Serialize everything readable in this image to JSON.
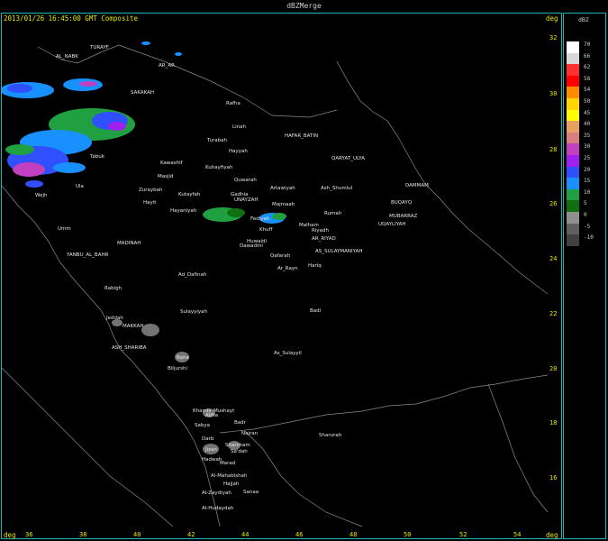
{
  "window": {
    "title": "dBZMerge"
  },
  "header": {
    "timestamp": "2013/01/26 16:45:00 GMT Composite",
    "unit": "deg"
  },
  "axes": {
    "corner_label_x": "deg",
    "corner_label_y": "deg",
    "lat_ticks": [
      "32",
      "30",
      "28",
      "26",
      "24",
      "22",
      "20",
      "18",
      "16"
    ],
    "lon_ticks": [
      "36",
      "38",
      "40",
      "42",
      "44",
      "46",
      "48",
      "50",
      "52",
      "54"
    ]
  },
  "legend": {
    "unit": "dBZ",
    "entries": [
      {
        "label": "70",
        "color": "#ffffff"
      },
      {
        "label": "66",
        "color": "#d8d8d8"
      },
      {
        "label": "62",
        "color": "#ff3030"
      },
      {
        "label": "58",
        "color": "#ff0000"
      },
      {
        "label": "54",
        "color": "#ff8c00"
      },
      {
        "label": "50",
        "color": "#ffd700"
      },
      {
        "label": "45",
        "color": "#ffff00"
      },
      {
        "label": "40",
        "color": "#e8a060"
      },
      {
        "label": "35",
        "color": "#d88080"
      },
      {
        "label": "30",
        "color": "#c040c0"
      },
      {
        "label": "25",
        "color": "#a020f0"
      },
      {
        "label": "20",
        "color": "#3050ff"
      },
      {
        "label": "15",
        "color": "#1890ff"
      },
      {
        "label": "10",
        "color": "#20a040"
      },
      {
        "label": "5",
        "color": "#107010"
      },
      {
        "label": "0",
        "color": "#909090"
      },
      {
        "label": "-5",
        "color": "#606060"
      },
      {
        "label": "-10",
        "color": "#404040"
      }
    ]
  },
  "places": [
    {
      "name": "TURAYF"
    },
    {
      "name": "AL_NABK"
    },
    {
      "name": "AR_AR"
    },
    {
      "name": "SAKAKAH"
    },
    {
      "name": "Rafha"
    },
    {
      "name": "Linah"
    },
    {
      "name": "HAFAR_BATIN"
    },
    {
      "name": "Turabah"
    },
    {
      "name": "Hayyah"
    },
    {
      "name": "QARYAT_ULYA"
    },
    {
      "name": "Tabuk"
    },
    {
      "name": "Kawashif"
    },
    {
      "name": "Kuhayfiyah"
    },
    {
      "name": "Masjid"
    },
    {
      "name": "Quwarah"
    },
    {
      "name": "Ula"
    },
    {
      "name": "Zuraybah"
    },
    {
      "name": "Kutayfah"
    },
    {
      "name": "Gadhia"
    },
    {
      "name": "UNAYZAH"
    },
    {
      "name": "Artawiyah"
    },
    {
      "name": "Ash_Shumlul"
    },
    {
      "name": "Wejh"
    },
    {
      "name": "Hayit"
    },
    {
      "name": "Hayaniyah"
    },
    {
      "name": "Majmaah"
    },
    {
      "name": "Rumah"
    },
    {
      "name": "DAMMAM"
    },
    {
      "name": "BUQAYQ"
    },
    {
      "name": "MUBARRAZ"
    },
    {
      "name": "UQAYLIYAH"
    },
    {
      "name": "Umm"
    },
    {
      "name": "Fediyah"
    },
    {
      "name": "Khuff"
    },
    {
      "name": "Malham"
    },
    {
      "name": "Riyadh"
    },
    {
      "name": "AR_RIYAD"
    },
    {
      "name": "MADINAH"
    },
    {
      "name": "Huwaidi"
    },
    {
      "name": "Dawadmi"
    },
    {
      "name": "AS_SULAYMANIYAH"
    },
    {
      "name": "YANBU_AL_BAHR"
    },
    {
      "name": "Qafarah"
    },
    {
      "name": "Ar_Rayn"
    },
    {
      "name": "Hariq"
    },
    {
      "name": "Ad_Dafinah"
    },
    {
      "name": "Rabigh"
    },
    {
      "name": "Sulayyiyah"
    },
    {
      "name": "Badi"
    },
    {
      "name": "Jeddah"
    },
    {
      "name": "MAKKAH"
    },
    {
      "name": "ASH_SHARIBA"
    },
    {
      "name": "Baha"
    },
    {
      "name": "As_Sulayyil"
    },
    {
      "name": "Biljurshi"
    },
    {
      "name": "Khamis_Mushayt"
    },
    {
      "name": "Abha"
    },
    {
      "name": "Badr"
    },
    {
      "name": "Najran"
    },
    {
      "name": "Sharurah"
    },
    {
      "name": "Sabya"
    },
    {
      "name": "Darb"
    },
    {
      "name": "Sharsham"
    },
    {
      "name": "Jizan"
    },
    {
      "name": "Sa'dah"
    },
    {
      "name": "Marad"
    },
    {
      "name": "Hadwah"
    },
    {
      "name": "Al-Mahabishah"
    },
    {
      "name": "Hajjah"
    },
    {
      "name": "Al-Zaydiyah"
    },
    {
      "name": "Sanaa"
    },
    {
      "name": "Al-Hudaydah"
    }
  ]
}
